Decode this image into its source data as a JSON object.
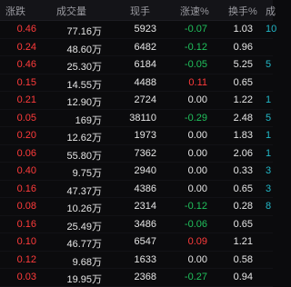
{
  "header": {
    "change": "涨跌",
    "volume": "成交量",
    "hand": "现手",
    "speed": "涨速%",
    "turnover": "换手%",
    "edge": "成"
  },
  "colors": {
    "up": "#ff3b3b",
    "down": "#20c05c",
    "neutral": "#e6e6e6",
    "extra": "#22b8c8"
  },
  "rows": [
    {
      "change": "0.46",
      "volume": "77.16万",
      "hand": "5923",
      "speed": "-0.07",
      "speed_dir": "down",
      "turnover": "1.03",
      "edge": "10"
    },
    {
      "change": "0.24",
      "volume": "48.60万",
      "hand": "6482",
      "speed": "-0.12",
      "speed_dir": "down",
      "turnover": "0.96",
      "edge": ""
    },
    {
      "change": "0.46",
      "volume": "25.30万",
      "hand": "6184",
      "speed": "-0.05",
      "speed_dir": "down",
      "turnover": "5.25",
      "edge": "5"
    },
    {
      "change": "0.15",
      "volume": "14.55万",
      "hand": "4488",
      "speed": "0.11",
      "speed_dir": "up",
      "turnover": "0.65",
      "edge": ""
    },
    {
      "change": "0.21",
      "volume": "12.90万",
      "hand": "2724",
      "speed": "0.00",
      "speed_dir": "flat",
      "turnover": "1.22",
      "edge": "1"
    },
    {
      "change": "0.05",
      "volume": "169万",
      "hand": "38110",
      "speed": "-0.29",
      "speed_dir": "down",
      "turnover": "2.48",
      "edge": "5"
    },
    {
      "change": "0.20",
      "volume": "12.62万",
      "hand": "1973",
      "speed": "0.00",
      "speed_dir": "flat",
      "turnover": "1.83",
      "edge": "1"
    },
    {
      "change": "0.06",
      "volume": "55.80万",
      "hand": "7362",
      "speed": "0.00",
      "speed_dir": "flat",
      "turnover": "2.06",
      "edge": "1"
    },
    {
      "change": "0.40",
      "volume": "9.75万",
      "hand": "2940",
      "speed": "0.00",
      "speed_dir": "flat",
      "turnover": "0.33",
      "edge": "3"
    },
    {
      "change": "0.16",
      "volume": "47.37万",
      "hand": "4386",
      "speed": "0.00",
      "speed_dir": "flat",
      "turnover": "0.65",
      "edge": "3"
    },
    {
      "change": "0.08",
      "volume": "10.26万",
      "hand": "2314",
      "speed": "-0.12",
      "speed_dir": "down",
      "turnover": "0.28",
      "edge": "8"
    },
    {
      "change": "0.16",
      "volume": "25.49万",
      "hand": "3486",
      "speed": "-0.06",
      "speed_dir": "down",
      "turnover": "0.65",
      "edge": ""
    },
    {
      "change": "0.10",
      "volume": "46.77万",
      "hand": "6547",
      "speed": "0.09",
      "speed_dir": "up",
      "turnover": "1.21",
      "edge": ""
    },
    {
      "change": "0.12",
      "volume": "9.68万",
      "hand": "1633",
      "speed": "0.00",
      "speed_dir": "flat",
      "turnover": "0.58",
      "edge": ""
    },
    {
      "change": "0.03",
      "volume": "19.95万",
      "hand": "2368",
      "speed": "-0.27",
      "speed_dir": "down",
      "turnover": "0.94",
      "edge": ""
    }
  ]
}
